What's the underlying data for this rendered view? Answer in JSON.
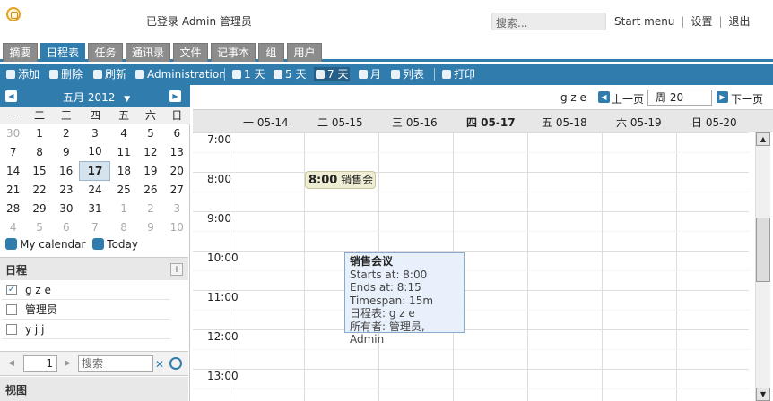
{
  "header": {
    "logged_in": "已登录 Admin 管理员",
    "search_placeholder": "搜索...",
    "links": [
      "Start menu",
      "设置",
      "退出"
    ]
  },
  "tabs": [
    "摘要",
    "日程表",
    "任务",
    "通讯录",
    "文件",
    "记事本",
    "组",
    "用户"
  ],
  "active_tab": "日程表",
  "toolbar": {
    "add": "添加",
    "delete": "删除",
    "refresh": "刷新",
    "admin": "Administration",
    "one_day": "1 天",
    "five_days": "5 天",
    "seven_days": "7 天",
    "month": "月",
    "list": "列表",
    "print": "打印"
  },
  "mini_calendar": {
    "month_label": "五月 2012",
    "weekdays": [
      "一",
      "二",
      "三",
      "四",
      "五",
      "六",
      "日"
    ],
    "weeks": [
      [
        "30",
        "1",
        "2",
        "3",
        "4",
        "5",
        "6"
      ],
      [
        "7",
        "8",
        "9",
        "10",
        "11",
        "12",
        "13"
      ],
      [
        "14",
        "15",
        "16",
        "17",
        "18",
        "19",
        "20"
      ],
      [
        "21",
        "22",
        "23",
        "24",
        "25",
        "26",
        "27"
      ],
      [
        "28",
        "29",
        "30",
        "31",
        "1",
        "2",
        "3"
      ],
      [
        "4",
        "5",
        "6",
        "7",
        "8",
        "9",
        "10"
      ]
    ],
    "today": "17"
  },
  "my_calendar": "My calendar",
  "today_label": "Today",
  "calendars": {
    "title": "日程",
    "items": [
      {
        "label": "g z e",
        "checked": "✓"
      },
      {
        "label": "管理员",
        "checked": ""
      },
      {
        "label": "y j j",
        "checked": ""
      }
    ]
  },
  "pager": {
    "page": "1",
    "search_placeholder": "搜索"
  },
  "views_title": "视图",
  "calendar_nav": {
    "owner": "g z e",
    "prev": "上一页",
    "week": "周 20",
    "next": "下一页"
  },
  "day_headers": [
    "一 05-14",
    "二 05-15",
    "三 05-16",
    "四 05-17",
    "五 05-18",
    "六 05-19",
    "日 05-20"
  ],
  "current_day": "四 05-17",
  "times": [
    "7:00",
    "8:00",
    "9:00",
    "10:00",
    "11:00",
    "12:00",
    "13:00"
  ],
  "event": {
    "time": "8:00",
    "title": "销售会"
  },
  "tooltip": {
    "title": "销售会议",
    "lines": [
      "Starts at: 8:00",
      "Ends at: 8:15",
      "Timespan: 15m",
      "日程表: g z e",
      "所有者: 管理员, Admin"
    ]
  },
  "colors": {
    "accent": "#2f7cad",
    "inactive_tab": "#8c8c8c",
    "event_bg": "#efeed5",
    "tooltip_bg": "#e8f1fb"
  }
}
